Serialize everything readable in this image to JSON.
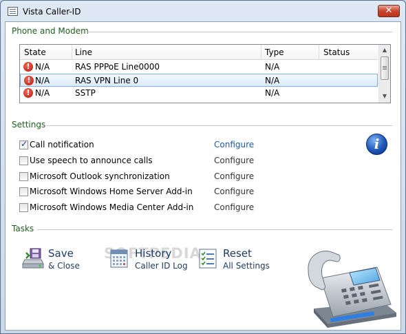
{
  "window": {
    "title": "Vista Caller-ID",
    "close_glyph": "✕"
  },
  "phone_section": {
    "label": "Phone and Modem",
    "columns": [
      "State",
      "Line",
      "Type",
      "Status"
    ],
    "rows": [
      {
        "state": "N/A",
        "line": "RAS PPPoE Line0000",
        "type": "N/A",
        "status": ""
      },
      {
        "state": "N/A",
        "line": "RAS VPN Line 0",
        "type": "N/A",
        "status": ""
      },
      {
        "state": "N/A",
        "line": "SSTP",
        "type": "N/A",
        "status": ""
      }
    ],
    "selected_row": 1
  },
  "settings_section": {
    "label": "Settings",
    "items": [
      {
        "label": "Call notification",
        "checked": true,
        "configure": "Configure",
        "configure_enabled": true
      },
      {
        "label": "Use speech to announce calls",
        "checked": false,
        "configure": "Configure",
        "configure_enabled": false
      },
      {
        "label": "Microsoft Outlook synchronization",
        "checked": false,
        "configure": "Configure",
        "configure_enabled": false
      },
      {
        "label": "Microsoft Windows Home Server Add-in",
        "checked": false,
        "configure": "Configure",
        "configure_enabled": false
      },
      {
        "label": "Microsoft Windows Media Center Add-in",
        "checked": false,
        "configure": "Configure",
        "configure_enabled": false
      }
    ],
    "info_icon": "info-icon"
  },
  "tasks_section": {
    "label": "Tasks",
    "items": [
      {
        "title": "Save",
        "subtitle": "& Close",
        "icon": "save-drive-icon"
      },
      {
        "title": "History",
        "subtitle": "Caller ID Log",
        "icon": "calendar-icon"
      },
      {
        "title": "Reset",
        "subtitle": "All Settings",
        "icon": "checklist-icon"
      }
    ]
  },
  "watermark": "SOFTPEDIA",
  "colors": {
    "section_label": "#1e5e1e",
    "link": "#1d5aa8",
    "task_text": "#1e3c62"
  }
}
